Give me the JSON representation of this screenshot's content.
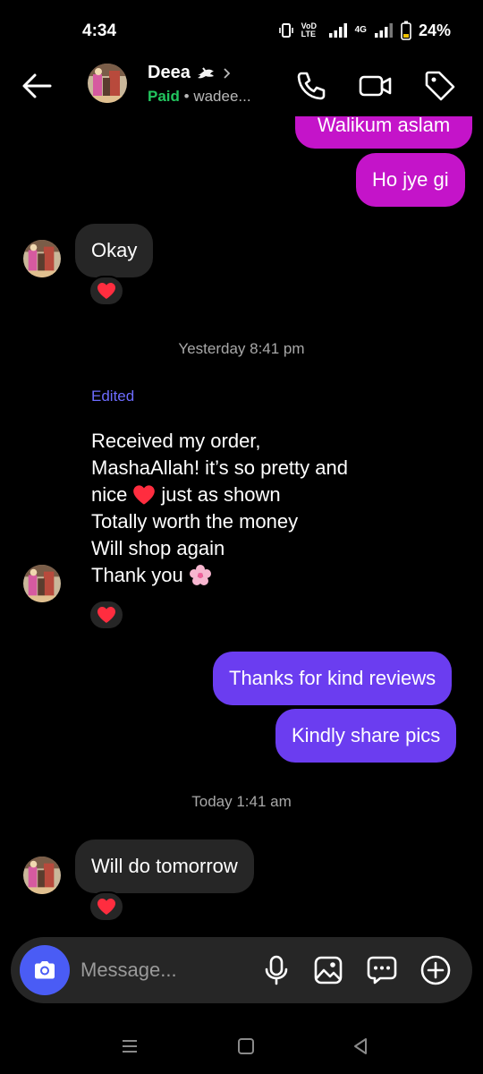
{
  "status": {
    "time": "4:34",
    "network": "VoD LTE",
    "net4g": "4G",
    "battery": "24%"
  },
  "header": {
    "name": "Deea",
    "name_emoji_icon": "dove-icon",
    "paid_label": "Paid",
    "separator": " • ",
    "username": "wadee..."
  },
  "messages": {
    "out1": "Walikum aslam",
    "out2": "Ho jye gi",
    "in1": "Okay",
    "ts1": "Yesterday 8:41 pm",
    "edited_label": "Edited",
    "review_lines": [
      "Received my order,",
      "MashaAllah! it’s so pretty and",
      "nice",
      "just as shown",
      "Totally worth the money",
      "Will shop again",
      "Thank you"
    ],
    "out3": "Thanks for kind reviews",
    "out4": "Kindly share pics",
    "ts2": "Today 1:41 am",
    "in2": "Will do tomorrow"
  },
  "composer": {
    "placeholder": "Message..."
  },
  "colors": {
    "outgoing_pink": "#c414c9",
    "outgoing_purple": "#6b3df0",
    "incoming": "#262626",
    "paid": "#22c55e",
    "edited": "#6d6cff",
    "camera": "#4a5cf5"
  }
}
